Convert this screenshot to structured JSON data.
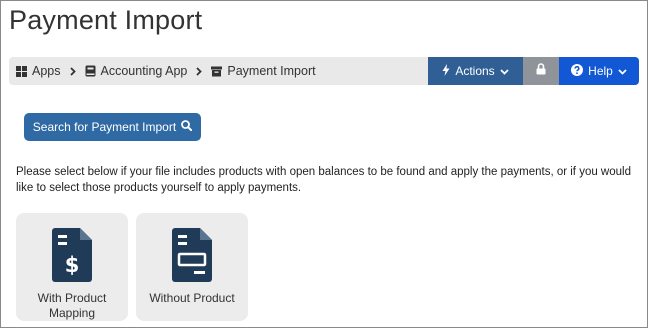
{
  "page": {
    "title": "Payment Import"
  },
  "breadcrumb": [
    {
      "label": "Apps",
      "icon": "grid-icon"
    },
    {
      "label": "Accounting App",
      "icon": "book-icon"
    },
    {
      "label": "Payment Import",
      "icon": "archive-icon"
    }
  ],
  "toolbar": {
    "actions_label": "Actions",
    "help_label": "Help"
  },
  "search": {
    "label": "Search for Payment Import"
  },
  "instructions": "Please select below if your file includes products with open balances to be found and apply the payments, or if you would like to select those products yourself to apply payments.",
  "options": [
    {
      "label": "With Product Mapping",
      "icon": "invoice-dollar-icon"
    },
    {
      "label": "Without Product",
      "icon": "invoice-blank-icon"
    }
  ],
  "colors": {
    "actions": "#2f5f95",
    "lock": "#8e9499",
    "help": "#1258d4",
    "search": "#2f6aa4",
    "doc_icon": "#1f3b57"
  }
}
